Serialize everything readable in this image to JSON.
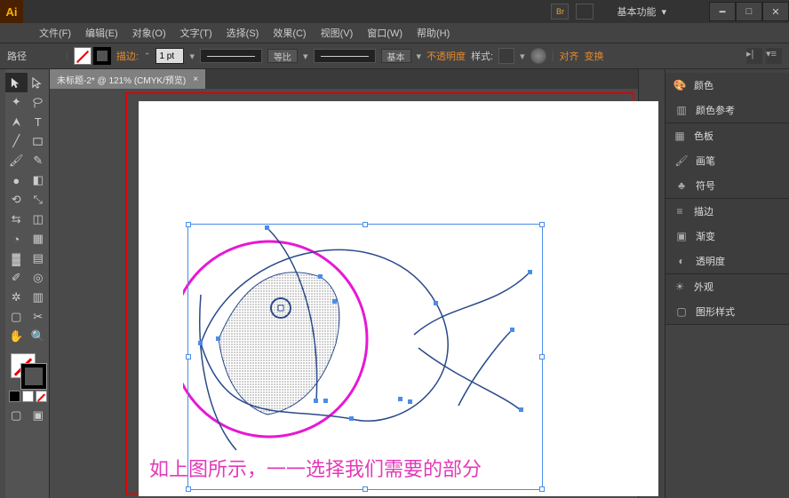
{
  "app": {
    "icon": "Ai",
    "preset_label": "基本功能"
  },
  "menu": [
    "文件(F)",
    "编辑(E)",
    "对象(O)",
    "文字(T)",
    "选择(S)",
    "效果(C)",
    "视图(V)",
    "窗口(W)",
    "帮助(H)"
  ],
  "options_bar": {
    "context": "路径",
    "stroke_label": "描边:",
    "stroke_value": "1 pt",
    "profile_label": "等比",
    "brush_label": "基本",
    "opacity_label": "不透明度",
    "style_label": "样式:",
    "align_label": "对齐",
    "transform_label": "变换"
  },
  "tab": {
    "title": "未标题-2* @ 121% (CMYK/预览)"
  },
  "caption": "如上图所示，一一选择我们需要的部分",
  "panels": {
    "color": "颜色",
    "color_guide": "颜色参考",
    "swatches": "色板",
    "brushes": "画笔",
    "symbols": "符号",
    "stroke": "描边",
    "gradient": "渐变",
    "transparency": "透明度",
    "appearance": "外观",
    "graphic_styles": "图形样式"
  },
  "tools": {
    "selection": "selection-tool",
    "direct": "direct-selection-tool",
    "wand": "magic-wand-tool",
    "lasso": "lasso-tool",
    "pen": "pen-tool",
    "type": "type-tool",
    "line": "line-tool",
    "rect": "rectangle-tool",
    "brush": "brush-tool",
    "pencil": "pencil-tool",
    "blob": "blob-brush-tool",
    "eraser": "eraser-tool",
    "rotate": "rotate-tool",
    "scale": "scale-tool",
    "width": "width-tool",
    "free": "free-transform-tool",
    "shapebuilder": "shape-builder-tool",
    "perspective": "perspective-tool",
    "mesh": "mesh-tool",
    "gradient": "gradient-tool",
    "eyedrop": "eyedropper-tool",
    "blend": "blend-tool",
    "spray": "symbol-sprayer-tool",
    "graph": "graph-tool",
    "artboard": "artboard-tool",
    "slice": "slice-tool",
    "hand": "hand-tool",
    "zoom": "zoom-tool"
  }
}
